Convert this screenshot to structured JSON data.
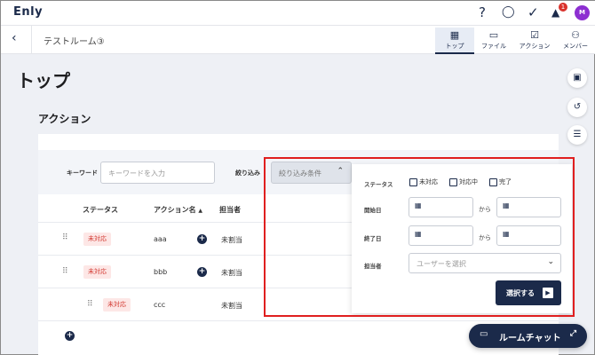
{
  "app": {
    "logo": "Enly"
  },
  "topbar": {
    "help_icon": "?",
    "chat_icon": "◯",
    "check_icon": "✓",
    "bell_icon": "▲",
    "notification_count": "1",
    "avatar_initial": "M"
  },
  "subbar": {
    "room_name": "テストルーム③",
    "tabs": [
      {
        "label": "トップ",
        "icon": "▦",
        "active": true
      },
      {
        "label": "ファイル",
        "icon": "▭",
        "active": false
      },
      {
        "label": "アクション",
        "icon": "☑",
        "active": false
      },
      {
        "label": "メンバー",
        "icon": "⚇",
        "active": false
      }
    ]
  },
  "page": {
    "title": "トップ"
  },
  "side_buttons": [
    "presentation-icon",
    "history-icon",
    "list-icon"
  ],
  "actions": {
    "section_title": "アクション",
    "keyword_label": "キーワード",
    "keyword_placeholder": "キーワードを入力",
    "narrow_label": "絞り込み",
    "narrow_value": "絞り込み条件",
    "columns": {
      "status": "ステータス",
      "name": "アクション名",
      "assignee": "担当者"
    },
    "rows": [
      {
        "status": "未対応",
        "name": "aaa",
        "assignee": "未割当"
      },
      {
        "status": "未対応",
        "name": "bbb",
        "assignee": "未割当"
      },
      {
        "status": "未対応",
        "name": "ccc",
        "assignee": "未割当"
      }
    ]
  },
  "filter_popup": {
    "status_label": "ステータス",
    "status_options": [
      "未対応",
      "対応中",
      "完了"
    ],
    "start_label": "開始日",
    "end_label": "終了日",
    "range_sep": "から",
    "assignee_label": "担当者",
    "assignee_placeholder": "ユーザーを選択",
    "submit_label": "選択する"
  },
  "chat": {
    "label": "ルームチャット"
  },
  "colors": {
    "navy": "#1b2a4a",
    "badge_red": "#d33a32",
    "highlight": "#e01f1f",
    "avatar": "#8d2fd1"
  }
}
